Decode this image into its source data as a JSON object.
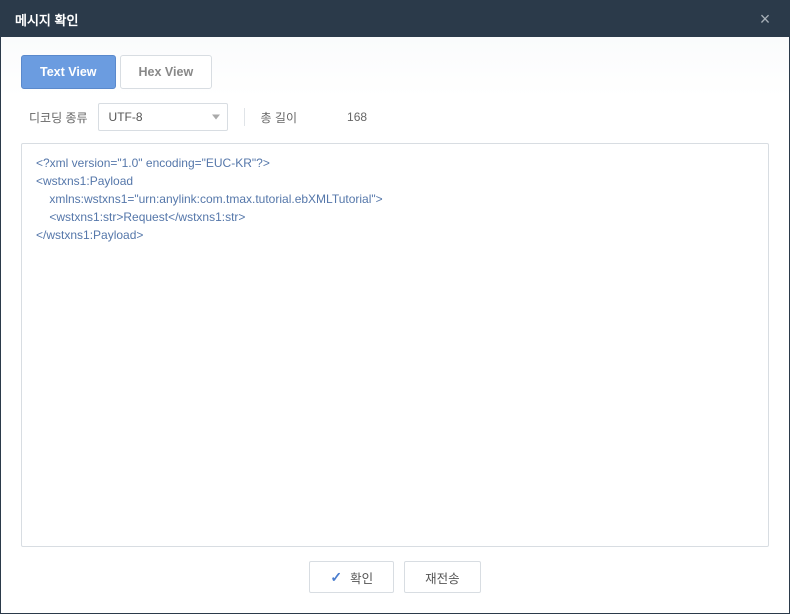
{
  "dialog": {
    "title": "메시지 확인"
  },
  "tabs": {
    "text_view": "Text View",
    "hex_view": "Hex View"
  },
  "controls": {
    "decoding_label": "디코딩 종류",
    "encoding_value": "UTF-8",
    "total_length_label": "총 길이",
    "total_length_value": "168"
  },
  "content": "<?xml version=\"1.0\" encoding=\"EUC-KR\"?>\n<wstxns1:Payload\n    xmlns:wstxns1=\"urn:anylink:com.tmax.tutorial.ebXMLTutorial\">\n    <wstxns1:str>Request</wstxns1:str>\n</wstxns1:Payload>",
  "buttons": {
    "confirm": "확인",
    "resend": "재전송"
  }
}
